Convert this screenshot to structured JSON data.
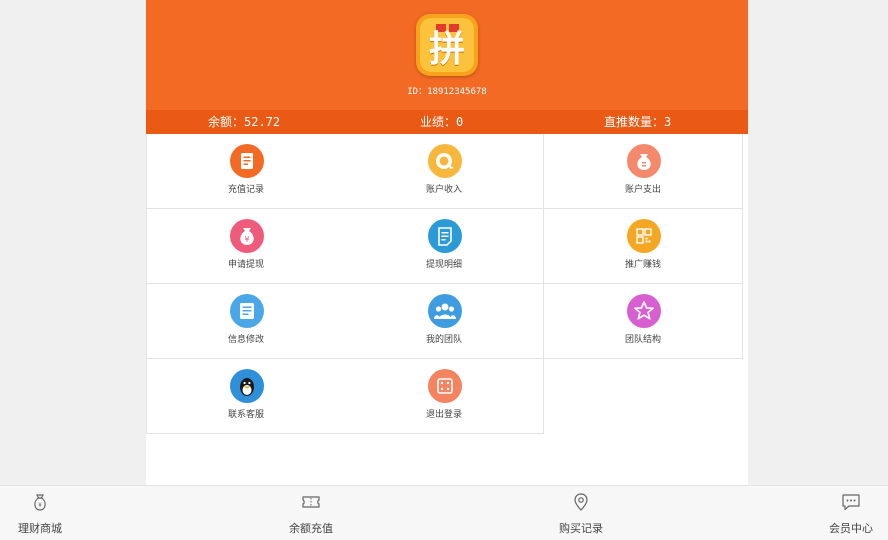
{
  "header": {
    "logo_char": "拼",
    "user_id": "ID：18912345678"
  },
  "stats": {
    "balance": "余额：52.72",
    "performance": "业绩：0",
    "direct_count": "直推数量：3"
  },
  "menu": [
    {
      "label": "充值记录",
      "icon": "recharge-record-icon",
      "color": "#f26a24"
    },
    {
      "label": "账户收入",
      "icon": "account-income-icon",
      "color": "#f6b73c"
    },
    {
      "label": "账户支出",
      "icon": "account-expense-icon",
      "color": "#f48a6b"
    },
    {
      "label": "申请提现",
      "icon": "withdraw-apply-icon",
      "color": "#ef5b7a"
    },
    {
      "label": "提现明细",
      "icon": "withdraw-detail-icon",
      "color": "#2b9ad6"
    },
    {
      "label": "推广赚钱",
      "icon": "promote-earn-icon",
      "color": "#f5a623"
    },
    {
      "label": "信息修改",
      "icon": "info-edit-icon",
      "color": "#4aa8e8"
    },
    {
      "label": "我的团队",
      "icon": "my-team-icon",
      "color": "#3d9de0"
    },
    {
      "label": "团队结构",
      "icon": "team-structure-icon",
      "color": "#d85fd0"
    },
    {
      "label": "联系客服",
      "icon": "contact-service-icon",
      "color": "#2f8fd8"
    },
    {
      "label": "退出登录",
      "icon": "logout-icon",
      "color": "#f4845f"
    }
  ],
  "bottom_nav": [
    {
      "label": "理财商城",
      "icon": "money-bag-icon"
    },
    {
      "label": "余额充值",
      "icon": "ticket-icon"
    },
    {
      "label": "购买记录",
      "icon": "location-pin-icon"
    },
    {
      "label": "会员中心",
      "icon": "chat-bubble-icon"
    }
  ],
  "colors": {
    "header_bg": "#f26a24",
    "stats_bg": "#ea5a15",
    "page_bg": "#f0f0f0"
  }
}
